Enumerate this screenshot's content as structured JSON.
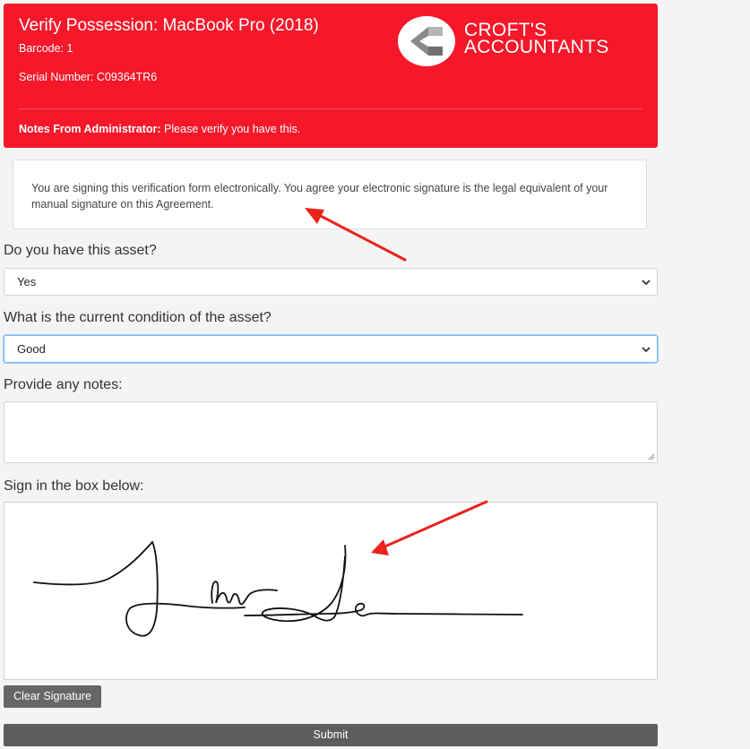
{
  "header": {
    "title": "Verify Possession: MacBook Pro (2018)",
    "barcode": "Barcode: 1",
    "serial": "Serial Number: C09364TR6",
    "notes_label": "Notes From Administrator:",
    "notes_text": " Please verify you have this."
  },
  "logo": {
    "line1": "CROFT'S",
    "line2": "ACCOUNTANTS"
  },
  "notice": {
    "text": "You are signing this verification form electronically. You agree your electronic signature is the legal equivalent of your manual signature on this Agreement."
  },
  "form": {
    "asset_question": "Do you have this asset?",
    "asset_value": "Yes",
    "condition_question": "What is the current condition of the asset?",
    "condition_value": "Good",
    "notes_question": "Provide any notes:",
    "sign_label": "Sign in the box below:"
  },
  "buttons": {
    "clear": "Clear Signature",
    "submit": "Submit"
  },
  "colors": {
    "header_bg": "#f5182a",
    "annotation_arrow": "#e8241c",
    "button_bg": "#5d5d5d"
  }
}
